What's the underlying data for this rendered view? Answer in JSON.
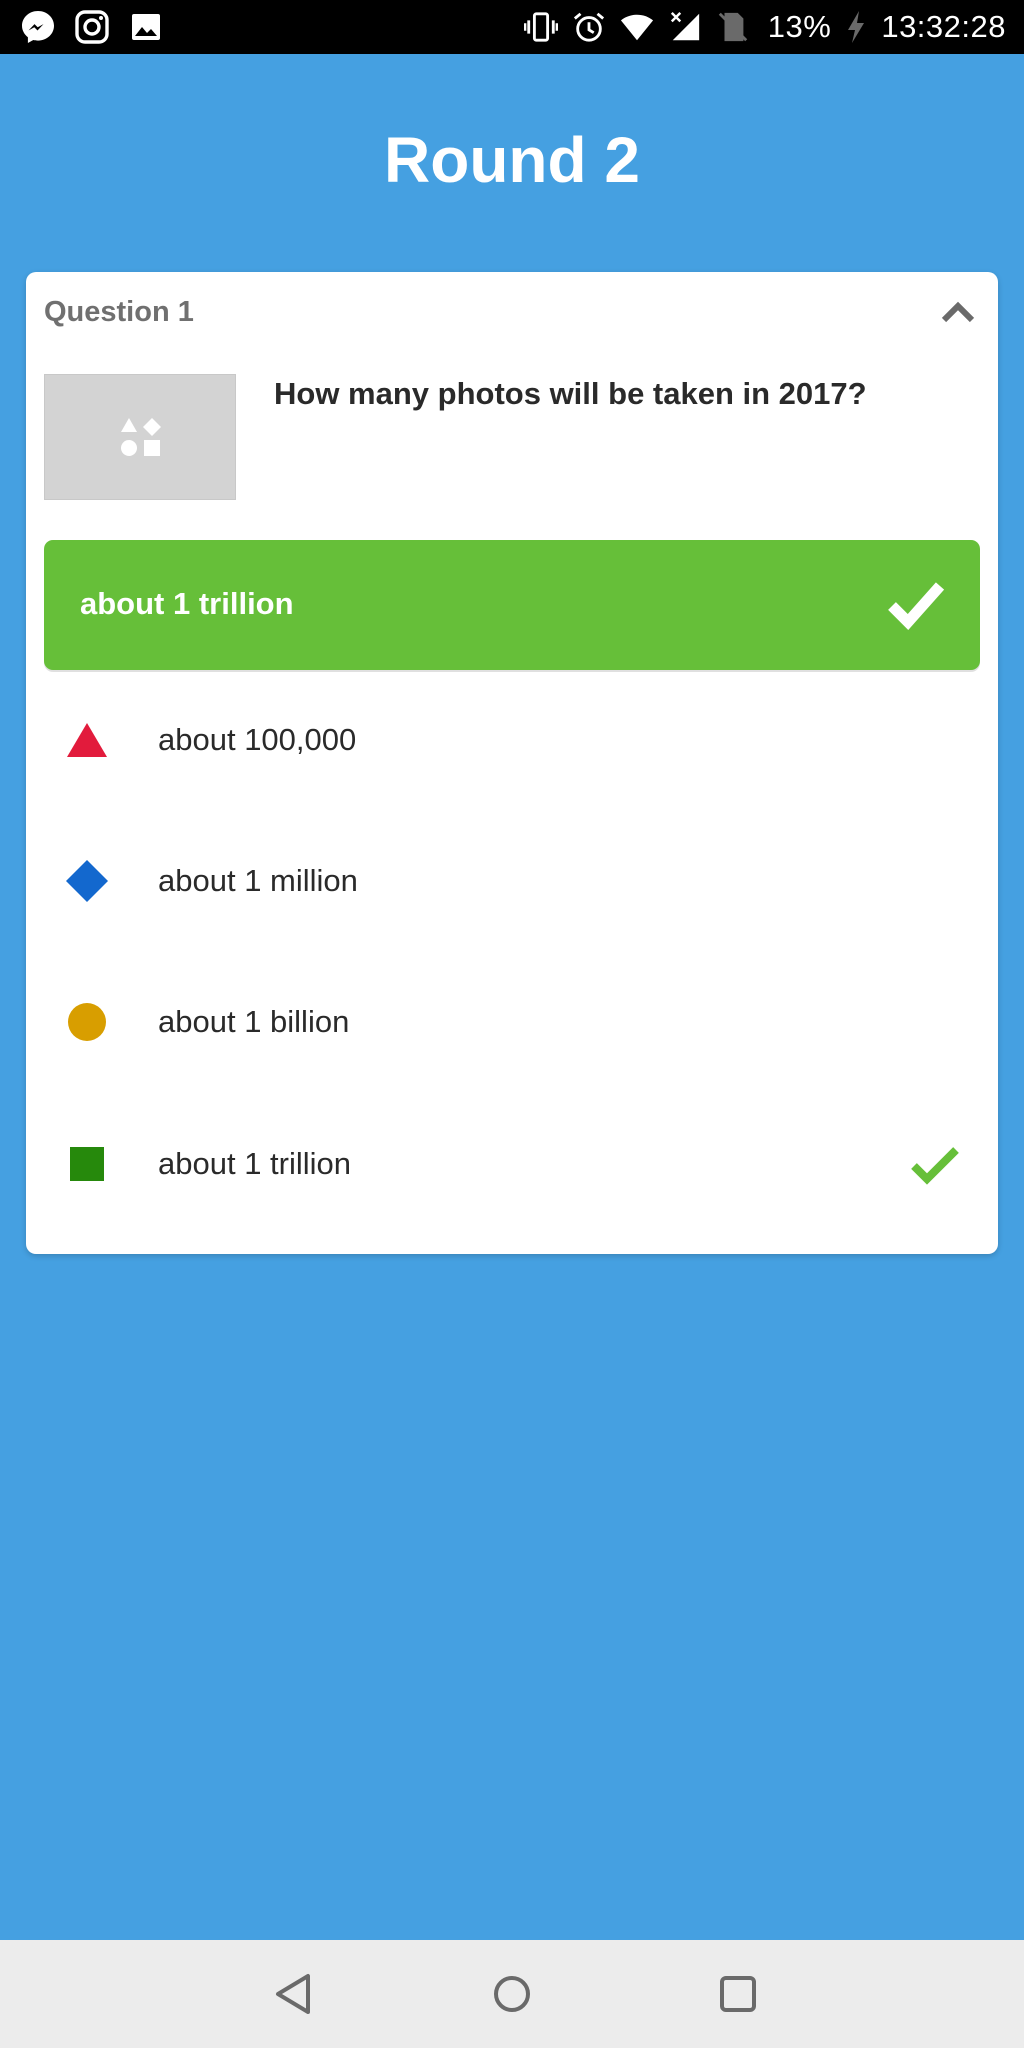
{
  "status_bar": {
    "left_icons": [
      "messenger-icon",
      "instagram-icon",
      "gallery-icon"
    ],
    "right_icons": [
      "vibrate-icon",
      "alarm-icon",
      "wifi-icon",
      "signal-icon",
      "no-sim-icon",
      "charging-icon"
    ],
    "battery": "13%",
    "time": "13:32:28"
  },
  "title": "Round 2",
  "question": {
    "label": "Question 1",
    "text": "How many photos will be taken in 2017?",
    "image_icon": "image-placeholder-shapes-icon",
    "correct_answer": "about 1 trillion"
  },
  "answers": [
    {
      "text": "about 100,000",
      "shape": "triangle-icon",
      "color": "#e21b3c",
      "correct": false
    },
    {
      "text": "about 1 million",
      "shape": "diamond-icon",
      "color": "#1368ce",
      "correct": false
    },
    {
      "text": "about 1 billion",
      "shape": "circle-icon",
      "color": "#d89e00",
      "correct": false
    },
    {
      "text": "about 1 trillion",
      "shape": "square-icon",
      "color": "#26890c",
      "correct": true
    }
  ],
  "colors": {
    "background": "#45a0e1",
    "correct_green": "#66bf39",
    "card": "#ffffff",
    "nav_bar": "#ececec"
  },
  "nav_bar": {
    "buttons": [
      "back-icon",
      "home-icon",
      "recents-icon"
    ]
  }
}
